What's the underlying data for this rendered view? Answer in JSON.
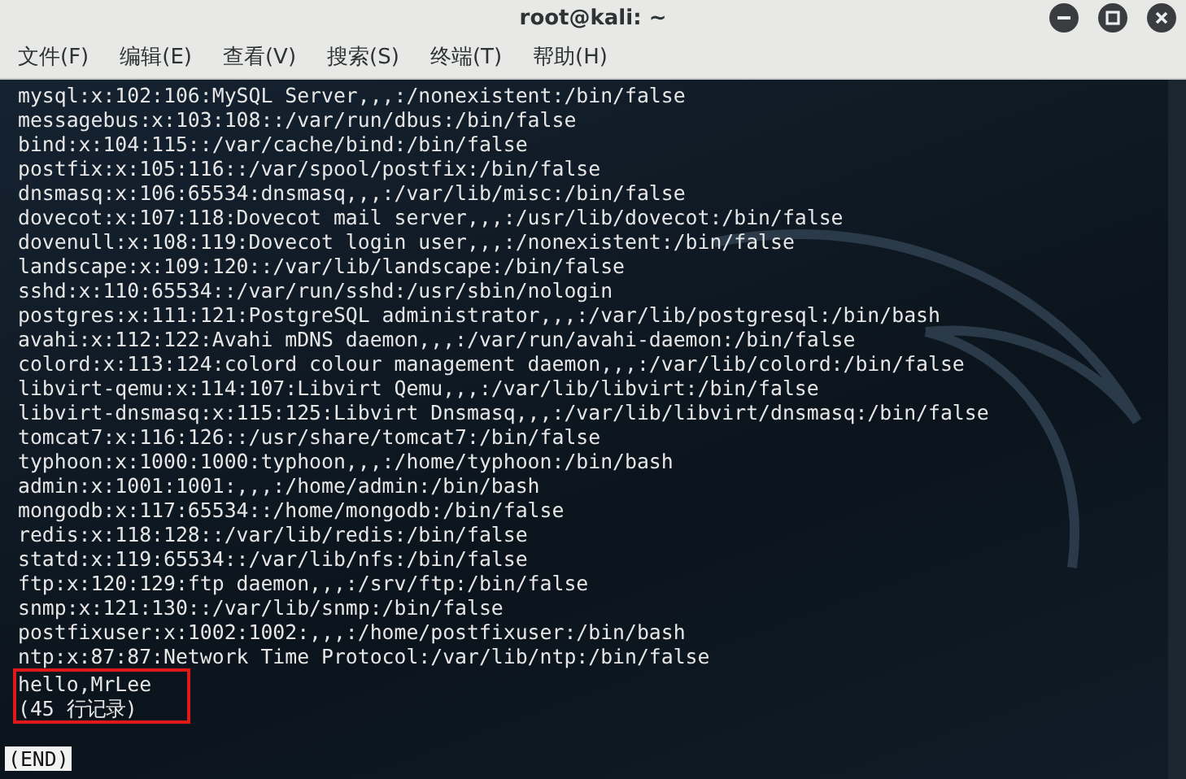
{
  "window": {
    "title": "root@kali: ~"
  },
  "menu": [
    "文件(F)",
    "编辑(E)",
    "查看(V)",
    "搜索(S)",
    "终端(T)",
    "帮助(H)"
  ],
  "terminal": {
    "lines": [
      {
        "text": "mysql:x:102:106:MySQL Server,,,:/nonexistent:/bin/false",
        "highlighted": false
      },
      {
        "text": "messagebus:x:103:108::/var/run/dbus:/bin/false",
        "highlighted": false
      },
      {
        "text": "bind:x:104:115::/var/cache/bind:/bin/false",
        "highlighted": false
      },
      {
        "text": "postfix:x:105:116::/var/spool/postfix:/bin/false",
        "highlighted": false
      },
      {
        "text": "dnsmasq:x:106:65534:dnsmasq,,,:/var/lib/misc:/bin/false",
        "highlighted": false
      },
      {
        "text": "dovecot:x:107:118:Dovecot mail server,,,:/usr/lib/dovecot:/bin/false",
        "highlighted": false
      },
      {
        "text": "dovenull:x:108:119:Dovecot login user,,,:/nonexistent:/bin/false",
        "highlighted": false
      },
      {
        "text": "landscape:x:109:120::/var/lib/landscape:/bin/false",
        "highlighted": false
      },
      {
        "text": "sshd:x:110:65534::/var/run/sshd:/usr/sbin/nologin",
        "highlighted": false
      },
      {
        "text": "postgres:x:111:121:PostgreSQL administrator,,,:/var/lib/postgresql:/bin/bash",
        "highlighted": false
      },
      {
        "text": "avahi:x:112:122:Avahi mDNS daemon,,,:/var/run/avahi-daemon:/bin/false",
        "highlighted": false
      },
      {
        "text": "colord:x:113:124:colord colour management daemon,,,:/var/lib/colord:/bin/false",
        "highlighted": false
      },
      {
        "text": "libvirt-qemu:x:114:107:Libvirt Qemu,,,:/var/lib/libvirt:/bin/false",
        "highlighted": false
      },
      {
        "text": "libvirt-dnsmasq:x:115:125:Libvirt Dnsmasq,,,:/var/lib/libvirt/dnsmasq:/bin/false",
        "highlighted": false
      },
      {
        "text": "tomcat7:x:116:126::/usr/share/tomcat7:/bin/false",
        "highlighted": false
      },
      {
        "text": "typhoon:x:1000:1000:typhoon,,,:/home/typhoon:/bin/bash",
        "highlighted": false
      },
      {
        "text": "admin:x:1001:1001:,,,:/home/admin:/bin/bash",
        "highlighted": false
      },
      {
        "text": "mongodb:x:117:65534::/home/mongodb:/bin/false",
        "highlighted": false
      },
      {
        "text": "redis:x:118:128::/var/lib/redis:/bin/false",
        "highlighted": false
      },
      {
        "text": "statd:x:119:65534::/var/lib/nfs:/bin/false",
        "highlighted": false
      },
      {
        "text": "ftp:x:120:129:ftp daemon,,,:/srv/ftp:/bin/false",
        "highlighted": false
      },
      {
        "text": "snmp:x:121:130::/var/lib/snmp:/bin/false",
        "highlighted": false
      },
      {
        "text": "postfixuser:x:1002:1002:,,,:/home/postfixuser:/bin/bash",
        "highlighted": false
      },
      {
        "text": "ntp:x:87:87:Network Time Protocol:/var/lib/ntp:/bin/false",
        "highlighted": false
      },
      {
        "text": "hello,MrLee",
        "highlighted": true
      },
      {
        "text": "(45 行记录)",
        "highlighted": true
      }
    ],
    "pager_status": "(END)"
  }
}
